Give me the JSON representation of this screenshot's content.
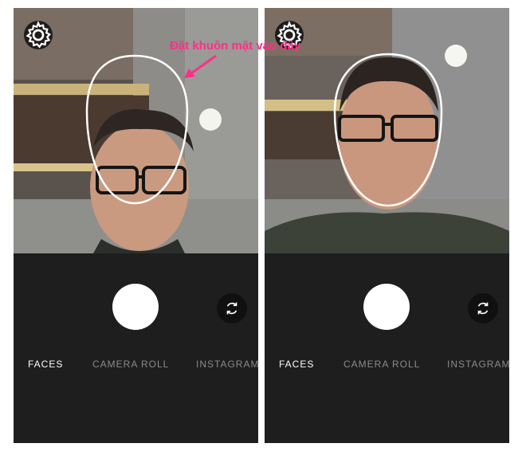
{
  "annotation": {
    "text": "Đặt khuôn mặt vào đây",
    "color": "#ff2f86"
  },
  "left_screen": {
    "settings_icon": "gear-icon",
    "flip_icon": "camera-flip-icon",
    "tabs": [
      {
        "label": "FACES",
        "active": true
      },
      {
        "label": "CAMERA ROLL",
        "active": false
      },
      {
        "label": "INSTAGRAM",
        "active": false
      }
    ]
  },
  "right_screen": {
    "settings_icon": "gear-icon",
    "flip_icon": "camera-flip-icon",
    "tabs": [
      {
        "label": "FACES",
        "active": true
      },
      {
        "label": "CAMERA ROLL",
        "active": false
      },
      {
        "label": "INSTAGRAM",
        "active": false
      }
    ]
  },
  "colors": {
    "panel": "#1e1e1e",
    "active_tab": "#ffffff",
    "inactive_tab": "#8a8a8a"
  }
}
